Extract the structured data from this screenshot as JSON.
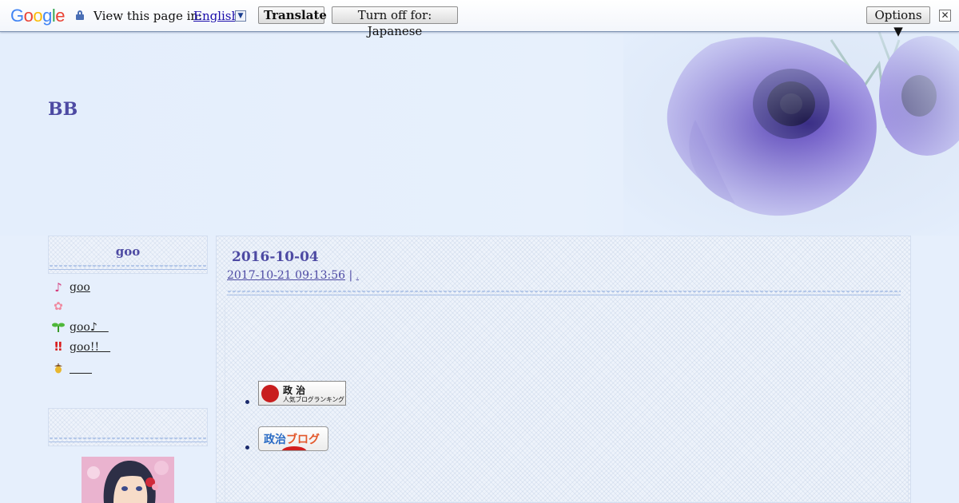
{
  "translate_bar": {
    "logo": "Google",
    "prompt": "View this page in:",
    "language": "English",
    "translate_label": "Translate",
    "turn_off_label": "Turn off for: Japanese",
    "options_label": "Options ▼",
    "close_symbol": "✕"
  },
  "header": {
    "site_title": "BB"
  },
  "sidebar": {
    "box_title": "goo",
    "links": [
      {
        "icon": "music-note-icon",
        "label": "goo"
      },
      {
        "icon": "flower-icon",
        "label": ""
      },
      {
        "icon": "sprout-icon",
        "label": "goo♪　"
      },
      {
        "icon": "double-exclamation-icon",
        "label": "goo!!　"
      },
      {
        "icon": "acorn-icon",
        "label": "　　"
      }
    ]
  },
  "post": {
    "title": "2016-10-04",
    "timestamp": "2017-10-21 09:13:56",
    "separator": "|",
    "trailing": ".",
    "banners": [
      {
        "name": "politics-blog-ranking-banner",
        "line1": "政 治",
        "line2": "人気ブログランキング"
      },
      {
        "name": "politics-blog-banner",
        "part1": "政治",
        "part2": "ブログ"
      }
    ]
  },
  "colors": {
    "accent": "#4d4aa3",
    "background": "#e6effc",
    "link": "#1a0dab"
  }
}
